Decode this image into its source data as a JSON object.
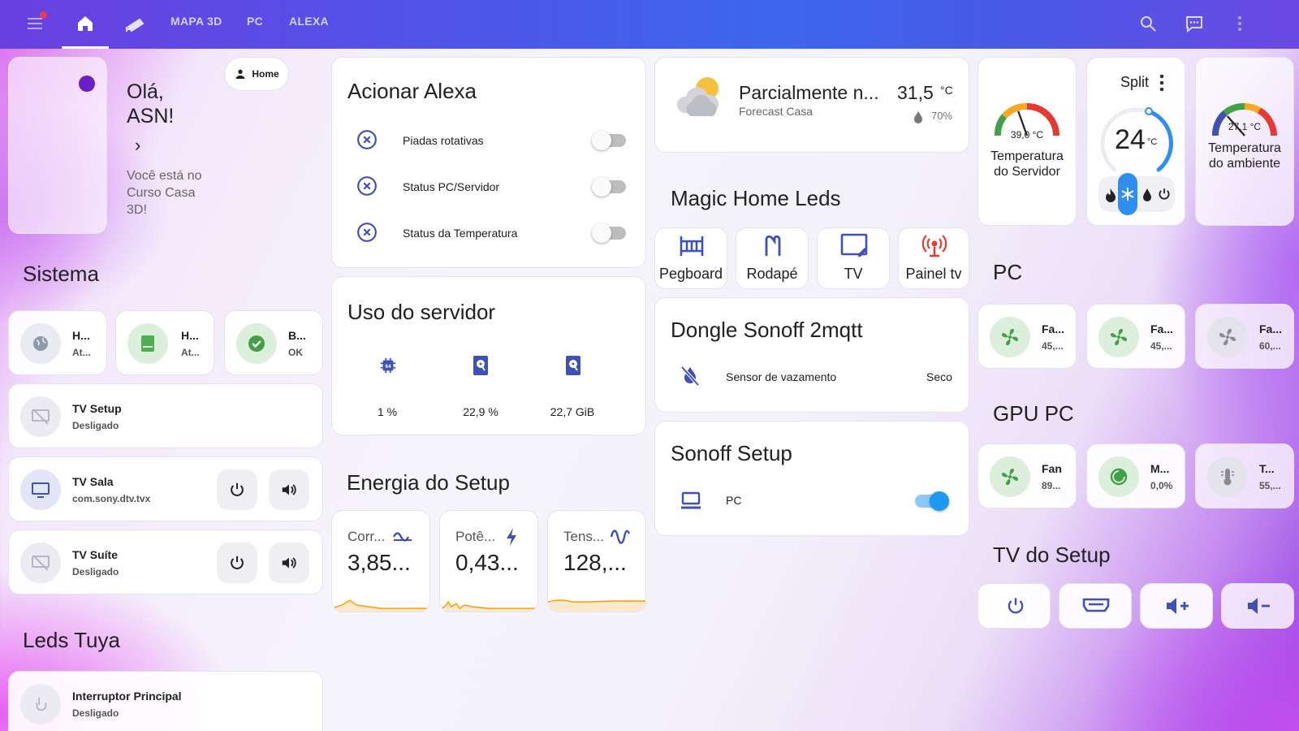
{
  "colors": {
    "accent": "#3f51b5",
    "green": "#4caf50",
    "teal": "#2e7d32",
    "blue": "#1e9bf0",
    "red": "#e53935",
    "orange": "#ff9800"
  },
  "topbar": {
    "tabs": [
      "MAPA 3D",
      "PC",
      "ALEXA"
    ],
    "icons": [
      "menu-icon",
      "home-icon",
      "cctv-icon",
      "search-icon",
      "assist-icon",
      "more-vert-icon"
    ]
  },
  "welcome": {
    "greeting": "Olá,",
    "name": "ASN!",
    "subtitle": "Você está no Curso Casa 3D!",
    "person_chip": "Home"
  },
  "sistema": {
    "title": "Sistema",
    "tiles": [
      {
        "name": "H...",
        "state": "At..."
      },
      {
        "name": "H...",
        "state": "At..."
      },
      {
        "name": "B...",
        "state": "OK"
      }
    ],
    "tv_setup": {
      "name": "TV Setup",
      "state": "Desligado"
    },
    "tv_sala": {
      "name": "TV Sala",
      "state": "com.sony.dtv.tvx"
    },
    "tv_suite": {
      "name": "TV Suíte",
      "state": "Desligado"
    }
  },
  "leds_tuya": {
    "title": "Leds Tuya",
    "switch": {
      "name": "Interruptor Principal",
      "state": "Desligado"
    }
  },
  "alexa": {
    "title": "Acionar Alexa",
    "rows": [
      {
        "label": "Piadas rotativas",
        "on": false
      },
      {
        "label": "Status PC/Servidor",
        "on": false
      },
      {
        "label": "Status da Temperatura",
        "on": false
      }
    ]
  },
  "servidor": {
    "title": "Uso do servidor",
    "values": [
      "1 %",
      "22,9 %",
      "22,7 GiB"
    ]
  },
  "energia": {
    "title": "Energia do Setup",
    "cards": [
      {
        "name": "Corr...",
        "value": "3,85..."
      },
      {
        "name": "Potê...",
        "value": "0,43..."
      },
      {
        "name": "Tens...",
        "value": "128,..."
      }
    ]
  },
  "weather": {
    "condition": "Parcialmente n...",
    "location": "Forecast Casa",
    "temp": "31,5",
    "unit": "°C",
    "humidity": "70%"
  },
  "magic_home": {
    "title": "Magic Home Leds",
    "buttons": [
      "Pegboard",
      "Rodapé",
      "TV",
      "Painel tv"
    ]
  },
  "dongle": {
    "title": "Dongle Sonoff 2mqtt",
    "sensor": "Sensor de vazamento",
    "state": "Seco"
  },
  "sonoff": {
    "title": "Sonoff Setup",
    "row": "PC",
    "on": true
  },
  "gauges": {
    "server": {
      "value": "39,0 °C",
      "label": "Temperatura do Servidor",
      "level": 0.39
    },
    "ambient": {
      "value": "27,1 °C",
      "label": "Temperatura do ambiente",
      "level": 0.27
    }
  },
  "split": {
    "title": "Split",
    "temp": "24",
    "unit": "°C",
    "mode": "cool"
  },
  "pc": {
    "title": "PC",
    "tiles": [
      {
        "name": "Fa...",
        "state": "45,..."
      },
      {
        "name": "Fa...",
        "state": "45,..."
      },
      {
        "name": "Fa...",
        "state": "60,..."
      }
    ]
  },
  "gpu": {
    "title": "GPU PC",
    "tiles": [
      {
        "name": "Fan",
        "state": "89..."
      },
      {
        "name": "M...",
        "state": "0,0%"
      },
      {
        "name": "T...",
        "state": "55,..."
      }
    ]
  },
  "tv_do_setup": {
    "title": "TV do Setup",
    "buttons": [
      "power-icon",
      "input-icon",
      "volume-up-icon",
      "volume-down-icon"
    ]
  }
}
